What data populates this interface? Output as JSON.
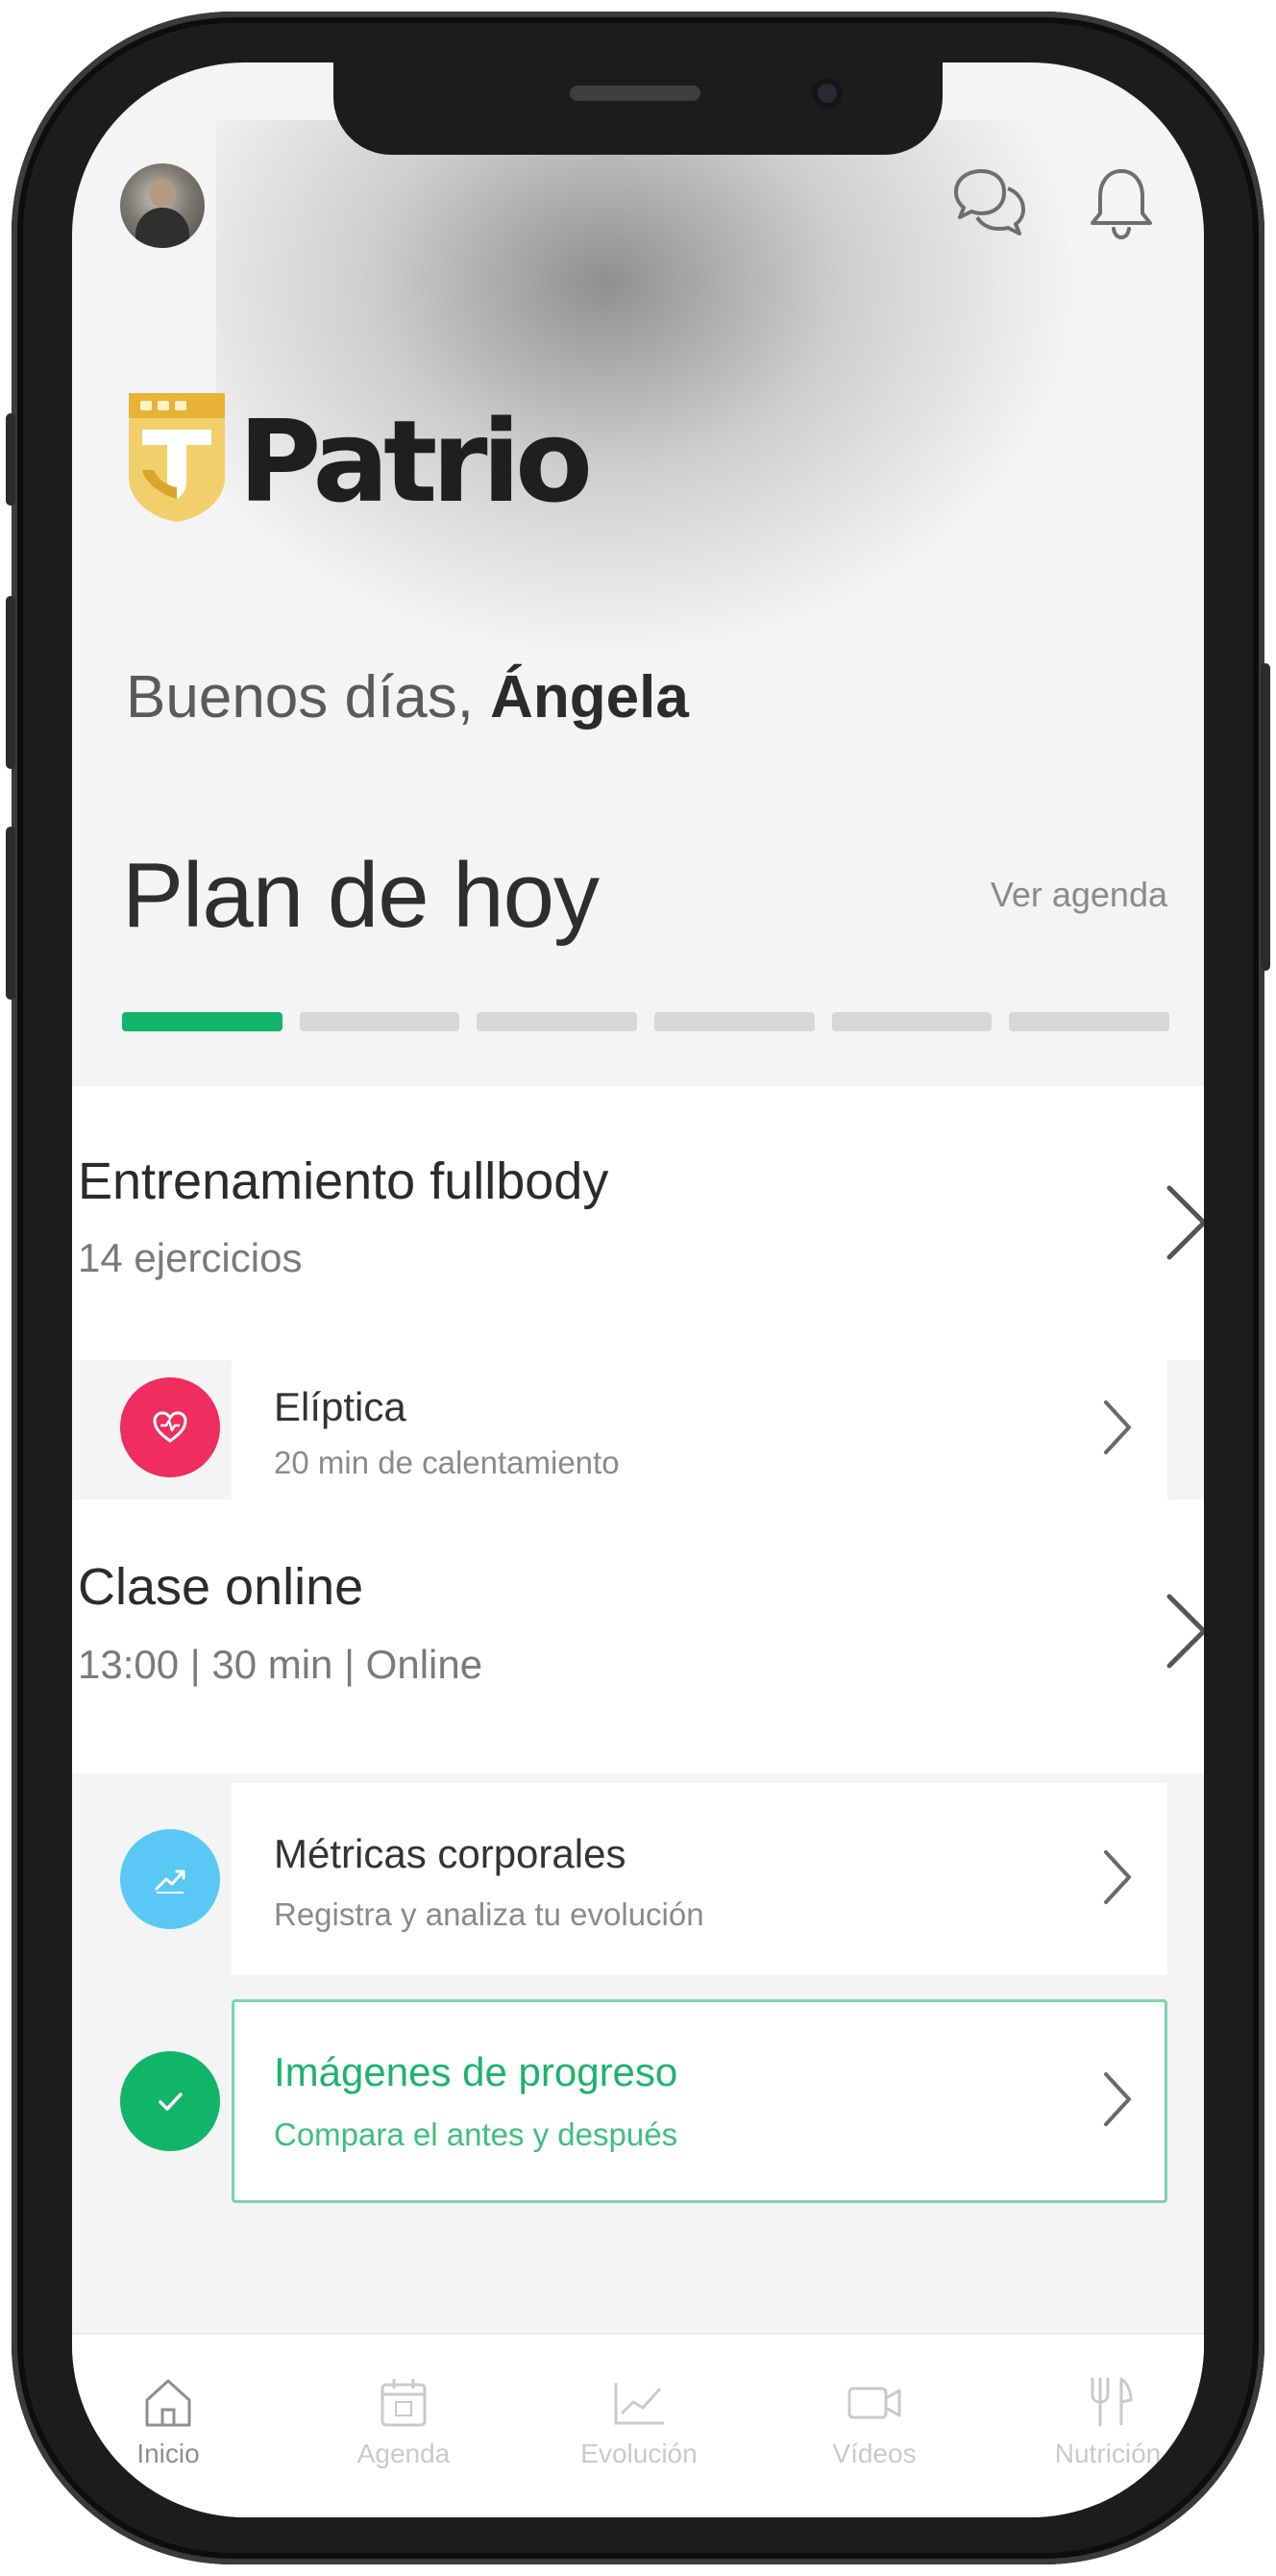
{
  "brand": {
    "name": "Patrio",
    "gold": "#e8b83a",
    "accent_green": "#11b56a"
  },
  "header": {
    "avatar_icon": "user-avatar",
    "chat_icon": "chat-bubbles-icon",
    "notifications_icon": "bell-icon"
  },
  "greeting": {
    "prefix": "Buenos días,",
    "name": "Ángela"
  },
  "plan": {
    "title": "Plan de hoy",
    "see_agenda": "Ver agenda",
    "progress": {
      "total_steps": 6,
      "completed_steps": 1
    }
  },
  "workout": {
    "title": "Entrenamiento fullbody",
    "subtitle": "14 ejercicios"
  },
  "elliptical": {
    "title": "Elíptica",
    "subtitle": "20 min de calentamiento",
    "icon": "heart-rate-icon",
    "color": "#ef2d5e"
  },
  "online_class": {
    "title": "Clase online",
    "subtitle": "13:00 | 30 min | Online"
  },
  "metrics": {
    "title": "Métricas corporales",
    "subtitle": "Registra y analiza tu evolución",
    "icon": "trend-chart-icon",
    "color": "#5ac8f5"
  },
  "progress_images": {
    "title": "Imágenes de progreso",
    "subtitle": "Compara el antes y después",
    "icon": "check-icon",
    "color": "#11b56a"
  },
  "bottom_nav": {
    "items": [
      {
        "label": "Inicio",
        "icon": "home-icon",
        "active": true
      },
      {
        "label": "Agenda",
        "icon": "calendar-icon",
        "active": false
      },
      {
        "label": "Evolución",
        "icon": "chart-icon",
        "active": false
      },
      {
        "label": "Vídeos",
        "icon": "video-icon",
        "active": false
      },
      {
        "label": "Nutrición",
        "icon": "fork-knife-icon",
        "active": false
      }
    ]
  }
}
